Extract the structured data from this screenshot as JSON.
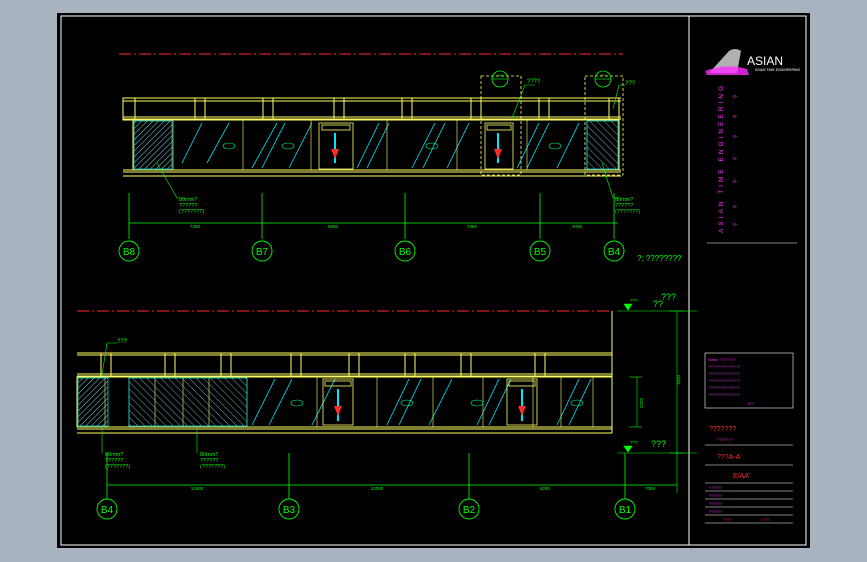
{
  "upper_elevation": {
    "grid_axes": [
      "B8",
      "B7",
      "B6",
      "B5",
      "B4"
    ],
    "dimensions": [
      "7250",
      "9000",
      "7250",
      "4000"
    ],
    "callouts": {
      "marker_a": "???",
      "marker_b": "???",
      "top_label": "????",
      "material_a": "80mm?",
      "material_a_line2": "??????",
      "material_a_line3": "(???????)",
      "material_b": "80mm?",
      "material_b_line2": "??????",
      "material_b_line3": "(???????)"
    },
    "note": "?: ????????"
  },
  "lower_elevation": {
    "grid_axes": [
      "B4",
      "B3",
      "B2",
      "B1"
    ],
    "dimensions": [
      "10080",
      "10080",
      "8280",
      "7000"
    ],
    "callouts": {
      "top_left": "???",
      "material_a": "80mm?",
      "material_a_line2": "??????",
      "material_a_line3": "(???????)",
      "material_b": "80mm?",
      "material_b_line2": "??????",
      "material_b_line3": "(???????)",
      "level_top_small": "???",
      "level_top": "???",
      "level_top_2": "??",
      "level_bottom_small": "???",
      "level_bottom": "???",
      "height_dim": "2720",
      "height_dim_2": "1650"
    }
  },
  "title_block": {
    "logo_text": "ASIAN",
    "logo_subtext": "ASIAN TIME ENGINEERING",
    "vertical_text": "ASIAN TIME ENGINEERING",
    "notes": [
      "Notes: ????????",
      "????????????????",
      "????????????????",
      "????????????????",
      "????????????????",
      "????????????????"
    ],
    "scale_label": "???",
    "drawing_name": "???????",
    "drawing_sub": "???????",
    "section_label": "???A-A'",
    "code": "E/AA'",
    "rows": [
      "??????",
      "??????",
      "??????",
      "??????"
    ],
    "footer_left": "????",
    "footer_right": "????"
  },
  "colors": {
    "background": "#000000",
    "frame": "#ffffff",
    "structure": "#ffff66",
    "glass": "#00e5ff",
    "dimension": "#00ff00",
    "centerline": "#ff2a2a",
    "annotation": "#ff2cff",
    "hatch": "#00c8d8"
  }
}
